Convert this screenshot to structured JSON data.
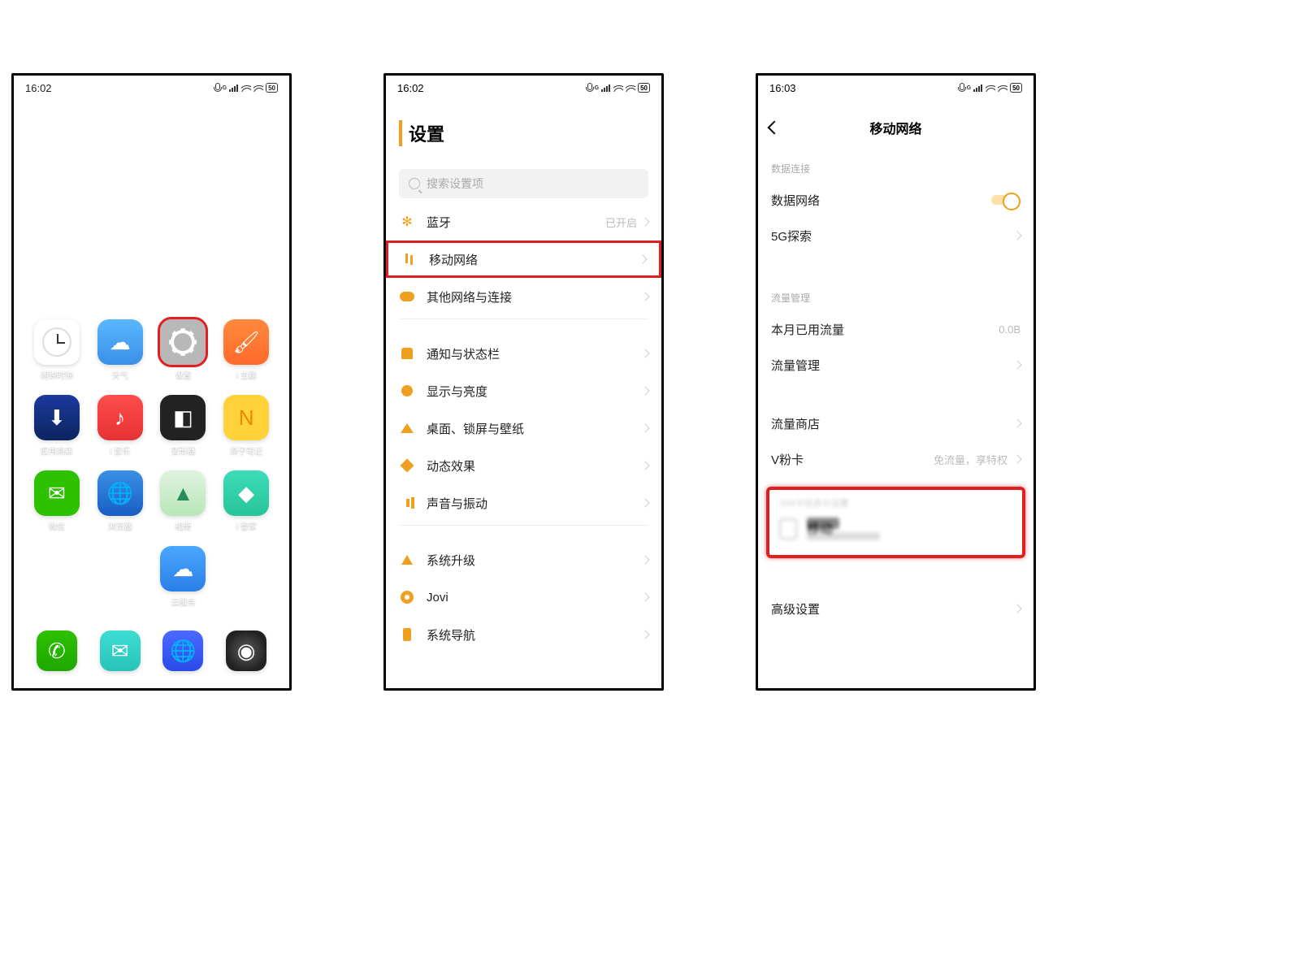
{
  "phone1": {
    "status": {
      "time": "16:02",
      "battery": "50"
    },
    "apps": [
      {
        "name": "clock",
        "label": "闹钟时钟",
        "cls": "ic-clock"
      },
      {
        "name": "weather",
        "label": "天气",
        "cls": "ic-weather"
      },
      {
        "name": "settings",
        "label": "设置",
        "cls": "ic-settings",
        "highlight": true
      },
      {
        "name": "theme",
        "label": "i 主题",
        "cls": "ic-theme"
      },
      {
        "name": "appstore",
        "label": "应用商店",
        "cls": "ic-appstore"
      },
      {
        "name": "music",
        "label": "i 音乐",
        "cls": "ic-music"
      },
      {
        "name": "transform",
        "label": "变形器",
        "cls": "ic-trans"
      },
      {
        "name": "notes",
        "label": "原子笔记",
        "cls": "ic-note"
      },
      {
        "name": "wechat",
        "label": "微信",
        "cls": "ic-wechat"
      },
      {
        "name": "browser",
        "label": "浏览器",
        "cls": "ic-browser"
      },
      {
        "name": "gallery",
        "label": "相册",
        "cls": "ic-gallery"
      },
      {
        "name": "guard",
        "label": "i 管家",
        "cls": "ic-guard"
      },
      {
        "name": "cloud",
        "label": "云服务",
        "cls": "ic-cloud"
      }
    ],
    "dock": [
      {
        "name": "phone",
        "cls": "ic-phone"
      },
      {
        "name": "sms",
        "cls": "ic-msg"
      },
      {
        "name": "globe",
        "cls": "ic-globe"
      },
      {
        "name": "camera",
        "cls": "ic-camera"
      }
    ]
  },
  "phone2": {
    "status": {
      "time": "16:02",
      "battery": "50"
    },
    "title": "设置",
    "search_placeholder": "搜索设置项",
    "groups": [
      [
        {
          "name": "bluetooth",
          "label": "蓝牙",
          "icon": "svg-bt2",
          "glyph": "✻",
          "right": "已开启"
        },
        {
          "name": "mobile-network",
          "label": "移动网络",
          "icon": "svg-net",
          "highlight": true
        },
        {
          "name": "other-network",
          "label": "其他网络与连接",
          "icon": "svg-cloud"
        }
      ],
      [
        {
          "name": "notification",
          "label": "通知与状态栏",
          "icon": "svg-bell"
        },
        {
          "name": "display",
          "label": "显示与亮度",
          "icon": "svg-sun"
        },
        {
          "name": "home-lock",
          "label": "桌面、锁屏与壁纸",
          "icon": "svg-home"
        },
        {
          "name": "dynamic",
          "label": "动态效果",
          "icon": "svg-diamond"
        },
        {
          "name": "sound",
          "label": "声音与振动",
          "icon": "svg-sound"
        }
      ],
      [
        {
          "name": "system-update",
          "label": "系统升级",
          "icon": "svg-up"
        },
        {
          "name": "jovi",
          "label": "Jovi",
          "icon": "svg-jovi"
        },
        {
          "name": "navigation",
          "label": "系统导航",
          "icon": "svg-nav"
        }
      ]
    ]
  },
  "phone3": {
    "status": {
      "time": "16:03",
      "battery": "50"
    },
    "title": "移动网络",
    "sections": {
      "data_conn_label": "数据连接",
      "data_network": "数据网络",
      "5g": "5G探索",
      "traffic_mgmt_label": "流量管理",
      "month_used": "本月已用流量",
      "month_used_value": "0.0B",
      "traffic_mgmt": "流量管理",
      "traffic_store": "流量商店",
      "vcard": "V粉卡",
      "vcard_hint": "免流量，享特权",
      "sim_section_label": "SIM卡信息与设置",
      "sim_name": "移动",
      "advanced": "高级设置"
    }
  }
}
